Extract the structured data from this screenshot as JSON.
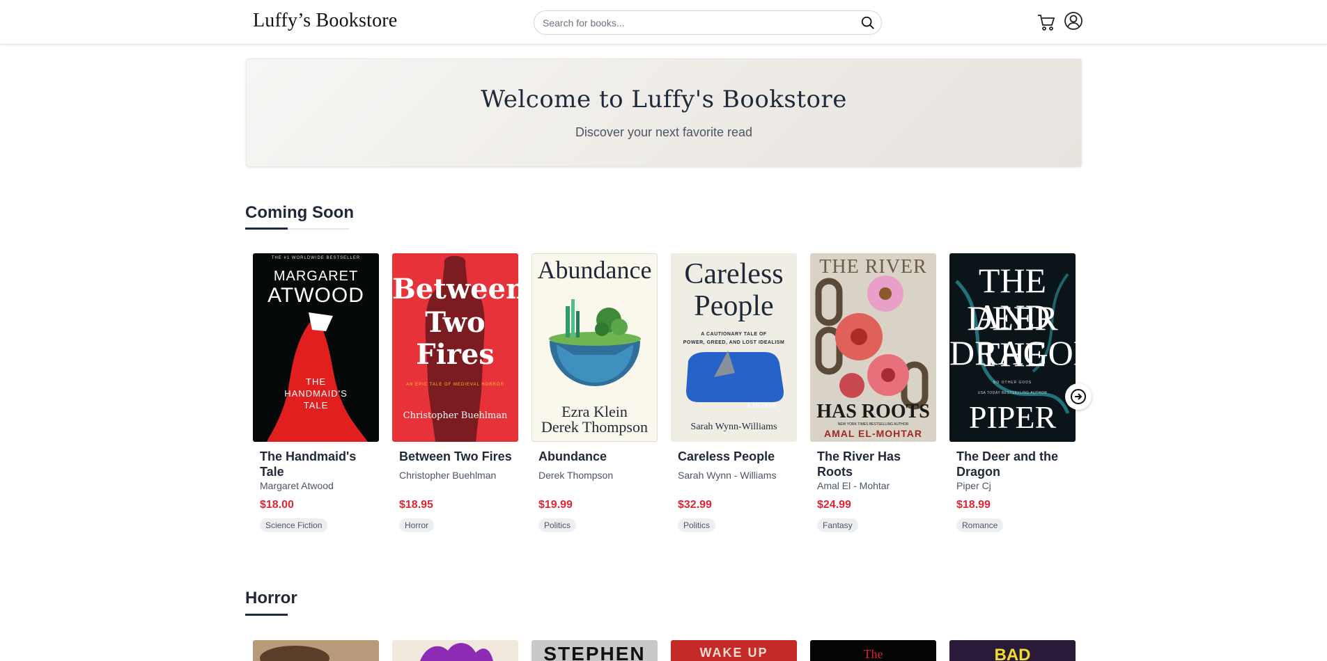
{
  "header": {
    "logo": "Luffy’s Bookstore",
    "search_placeholder": "Search for books...",
    "icons": [
      "search-icon",
      "cart-icon",
      "user-icon"
    ]
  },
  "hero": {
    "title": "Welcome to Luffy's Bookstore",
    "subtitle": "Discover your next favorite read"
  },
  "sections": [
    {
      "title": "Coming Soon",
      "books": [
        {
          "title": "The Handmaid's Tale",
          "author": "Margaret Atwood",
          "price": "$18.00",
          "genre": "Science Fiction",
          "cover_lines": [
            "THE #1 WORLDWIDE BESTSELLER",
            "MARGARET",
            "ATWOOD",
            "THE",
            "HANDMAID'S",
            "TALE"
          ]
        },
        {
          "title": "Between Two Fires",
          "author": "Christopher Buehlman",
          "price": "$18.95",
          "genre": "Horror",
          "cover_lines": [
            "Between",
            "Two",
            "Fires",
            "AN EPIC TALE OF MEDIEVAL HORROR",
            "Christopher Buehlman"
          ]
        },
        {
          "title": "Abundance",
          "author": "Derek Thompson",
          "price": "$19.99",
          "genre": "Politics",
          "cover_lines": [
            "Abundance",
            "Ezra Klein",
            "Derek Thompson"
          ]
        },
        {
          "title": "Careless People",
          "author": "Sarah Wynn - Williams",
          "price": "$32.99",
          "genre": "Politics",
          "cover_lines": [
            "Careless",
            "People",
            "A CAUTIONARY TALE OF",
            "POWER, GREED, AND LOST IDEALISM",
            "A MEMOIR",
            "Sarah Wynn-Williams"
          ]
        },
        {
          "title": "The River Has Roots",
          "author": "Amal El - Mohtar",
          "price": "$24.99",
          "genre": "Fantasy",
          "cover_lines": [
            "THE RIVER",
            "HAS ROOTS",
            "NEW YORK TIMES BESTSELLING AUTHOR",
            "AMAL EL-MOHTAR"
          ]
        },
        {
          "title": "The Deer and the Dragon",
          "author": "Piper Cj",
          "price": "$18.99",
          "genre": "Romance",
          "cover_lines": [
            "THE DEER",
            "AND THE",
            "DRAGON",
            "NO OTHER GODS",
            "USA TODAY BESTSELLING AUTHOR",
            "PIPER CJ"
          ]
        }
      ]
    },
    {
      "title": "Horror",
      "cover_peeks": [
        "",
        "",
        "STEPHEN",
        "WAKE UP",
        "The",
        "BAD"
      ]
    }
  ],
  "colors": {
    "accent_price": "#dc2635",
    "heading_dark": "#1e2a3a",
    "tag_bg": "#eceff2"
  }
}
